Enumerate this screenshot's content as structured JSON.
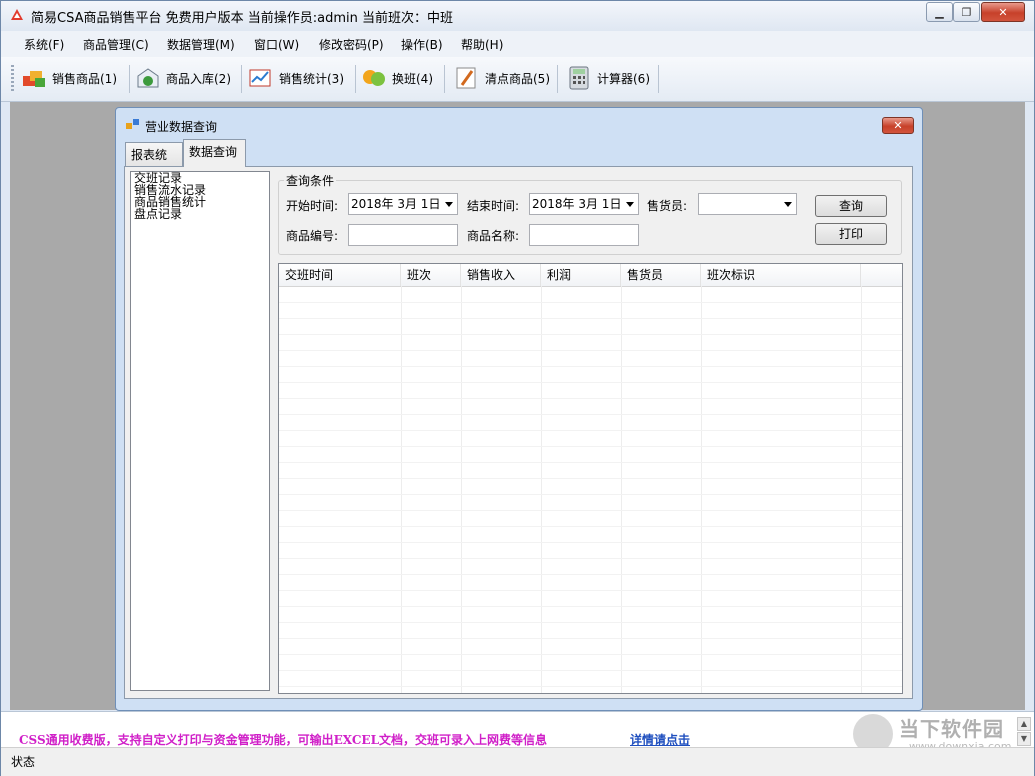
{
  "window": {
    "title": "简易CSA商品销售平台 免费用户版本 当前操作员:admin 当前班次：中班",
    "minimize_glyph": "▁",
    "restore_glyph": "❐",
    "close_glyph": "✕"
  },
  "menu": [
    "系统(F)",
    "商品管理(C)",
    "数据管理(M)",
    "窗口(W)",
    "修改密码(P)",
    "操作(B)",
    "帮助(H)"
  ],
  "toolbar": [
    {
      "label": "销售商品(1)",
      "icon": "products-icon"
    },
    {
      "label": "商品入库(2)",
      "icon": "stock-in-icon"
    },
    {
      "label": "销售统计(3)",
      "icon": "sales-stats-icon"
    },
    {
      "label": "换班(4)",
      "icon": "shift-change-icon"
    },
    {
      "label": "清点商品(5)",
      "icon": "inventory-pencil-icon"
    },
    {
      "label": "计算器(6)",
      "icon": "calculator-icon"
    }
  ],
  "dialog": {
    "title": "营业数据查询",
    "close_glyph": "✕",
    "tabs": [
      {
        "label": "报表统计",
        "active": false
      },
      {
        "label": "数据查询",
        "active": true
      }
    ],
    "tree": [
      "交班记录",
      "销售流水记录",
      "商品销售统计",
      "盘点记录"
    ],
    "query": {
      "legend": "查询条件",
      "start_label": "开始时间:",
      "start_value": "2018年 3月 1日",
      "end_label": "结束时间:",
      "end_value": "2018年 3月 1日",
      "seller_label": "售货员:",
      "seller_value": "",
      "code_label": "商品编号:",
      "code_value": "",
      "name_label": "商品名称:",
      "name_value": "",
      "search_button": "查询",
      "print_button": "打印"
    },
    "grid": {
      "columns": [
        "交班时间",
        "班次",
        "销售收入",
        "利润",
        "售货员",
        "班次标识"
      ],
      "rows": []
    }
  },
  "ad": {
    "text": "CSS通用收费版，支持自定义打印与资金管理功能，可输出EXCEL文档，交班可录入上网费等信息",
    "link": "详情请点击"
  },
  "status": "状态",
  "watermark": {
    "text": "当下软件园",
    "url": "www.downxia.com"
  },
  "colors": {
    "ad_text": "#d020c8",
    "ad_link": "#1f4fbf",
    "workspace": "#a9a9a9"
  }
}
